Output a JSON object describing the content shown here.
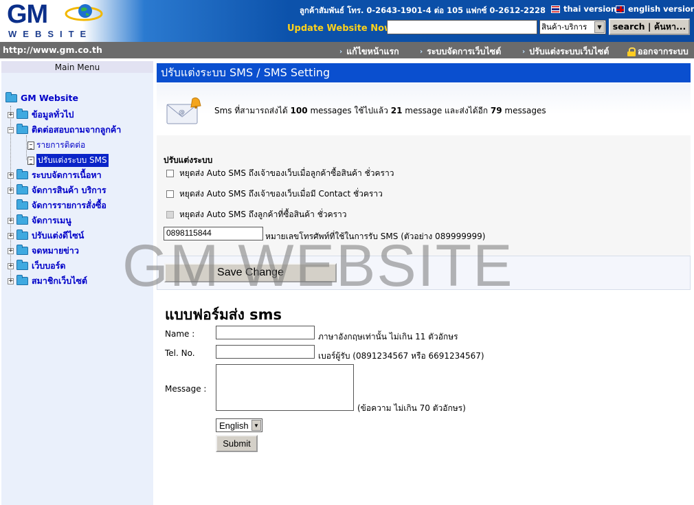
{
  "header": {
    "logo_text": "GM",
    "logo_subtext": "WEBSITE",
    "contact": "ลูกค้าสัมพันธ์ โทร. 0-2643-1901-4 ต่อ 105 แฟกซ์ 0-2612-2228",
    "thai_version_label": "thai version",
    "english_version_label": "english version",
    "update_label": "Update Website Now!",
    "search_value": "",
    "category_selected": "สินค้า-บริการ",
    "search_button_label": "search | ค้นหา...",
    "flag_colors": {
      "thai": [
        "#cc0000",
        "#ffffff",
        "#1a2a8a"
      ],
      "uk": [
        "#1a2a8a",
        "#cc0000"
      ]
    }
  },
  "navbar": {
    "url": "http://www.gm.co.th",
    "links": [
      {
        "label": "แก้ไขหน้าแรก"
      },
      {
        "label": "ระบบจัดการเว็บไซต์"
      },
      {
        "label": "ปรับแต่งระบบเว็บไซต์"
      },
      {
        "label": "ออกจากระบบ"
      }
    ]
  },
  "sidebar": {
    "title": "Main Menu",
    "root": "GM Website",
    "items": [
      {
        "label": "ข้อมูลทั่วไป",
        "expander": "+"
      },
      {
        "label": "ติดต่อสอบถามจากลูกค้า",
        "expander": "−"
      },
      {
        "label": "รายการติดต่อ"
      },
      {
        "label": "ปรับแต่งระบบ SMS",
        "selected": true
      },
      {
        "label": "ระบบจัดการเนื้อหา",
        "expander": "+"
      },
      {
        "label": "จัดการสินค้า บริการ",
        "expander": "+"
      },
      {
        "label": "จัดการรายการสั่งซื้อ"
      },
      {
        "label": "จัดการเมนู",
        "expander": "+"
      },
      {
        "label": "ปรับแต่งดีไซน์",
        "expander": "+"
      },
      {
        "label": "จดหมายข่าว",
        "expander": "+"
      },
      {
        "label": "เว็บบอร์ด",
        "expander": "+"
      },
      {
        "label": "สมาชิกเว็บไซต์",
        "expander": "+"
      }
    ]
  },
  "main": {
    "title": "ปรับแต่งระบบ SMS / SMS Setting",
    "info": {
      "prefix": "Sms ที่สามารถส่งได้",
      "total": "100",
      "mid1": "messages ใช้ไปแล้ว",
      "used": "21",
      "mid2": "message และส่งได้อีก",
      "remaining": "79",
      "suffix": "messages"
    },
    "settings": {
      "heading": "ปรับแต่งระบบ",
      "options": [
        {
          "label": "หยุดส่ง Auto SMS ถึงเจ้าของเว็บเมื่อลูกค้าซื้อสินค้า ชั่วคราว",
          "checked": false,
          "disabled": false
        },
        {
          "label": "หยุดส่ง Auto SMS ถึงเจ้าของเว็บเมื่อมี Contact ชั่วคราว",
          "checked": false,
          "disabled": false
        },
        {
          "label": "หยุดส่ง Auto SMS ถึงลูกค้าที่ซื้อสินค้า ชั่วคราว",
          "checked": false,
          "disabled": true
        }
      ],
      "phone_value": "0898115844",
      "phone_hint": "หมายเลขโทรศัพท์ที่ใช้ในการรับ SMS (ตัวอย่าง 089999999)",
      "save_label": "Save Change"
    },
    "sms_form": {
      "title": "แบบฟอร์มส่ง sms",
      "name_label": "Name :",
      "name_value": "",
      "name_hint": "ภาษาอังกฤษเท่านั้น ไม่เกิน 11 ตัวอักษร",
      "tel_label": "Tel. No.",
      "tel_value": "",
      "tel_hint": "เบอร์ผู้รับ (0891234567 หรือ 6691234567)",
      "message_label": "Message :",
      "message_value": "",
      "message_hint": "(ข้อความ ไม่เกิน 70 ตัวอักษร)",
      "language_selected": "English",
      "submit_label": "Submit"
    }
  },
  "watermark": "GM WEBSITE"
}
